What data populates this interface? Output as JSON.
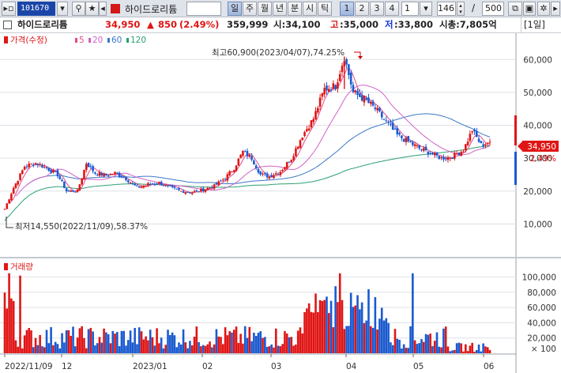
{
  "toolbar": {
    "code": "101670",
    "name": "하이드로리튬",
    "periods": [
      "일",
      "주",
      "월",
      "년",
      "분",
      "시",
      "틱"
    ],
    "active_period": "일",
    "chart_tabs": [
      "1",
      "2",
      "3",
      "4"
    ],
    "active_tab": "1",
    "interval_value": "1",
    "count_value": "146",
    "separator": "/",
    "total_value": "500"
  },
  "quote": {
    "name": "하이드로리튬",
    "price": "34,950",
    "change": "850",
    "change_pct": "(2.49%)",
    "volume": "359,999",
    "open": "시:34,100",
    "high_label": "고",
    "high": ":35,000",
    "low_label": "저",
    "low": ":33,800",
    "market_cap": "시총:7,805억",
    "period_badge": "[1일]"
  },
  "price_legend": {
    "title": "가격(수정)",
    "ma": [
      {
        "label": "5",
        "color": "#e04c8c"
      },
      {
        "label": "20",
        "color": "#d060c8"
      },
      {
        "label": "60",
        "color": "#3a78c8"
      },
      {
        "label": "120",
        "color": "#2aa070"
      }
    ]
  },
  "annotations": {
    "high": "최고60,900(2023/04/07),74.25%",
    "low": "최저14,550(2022/11/09),58.37%"
  },
  "current_price_tag": "34,950",
  "current_pct_tag": "2.49%",
  "volume_legend": "거래량",
  "volume_unit": "× 100",
  "colors": {
    "up": "#e01515",
    "down": "#1a5ad0",
    "ma5": "#e04c8c",
    "ma20": "#d060c8",
    "ma60": "#3a78c8",
    "ma120": "#2aa070"
  },
  "chart_data": [
    {
      "type": "candlestick",
      "title": "하이드로리튬 가격(수정)",
      "ylim": [
        0,
        68000
      ],
      "yticks": [
        "10,000",
        "20,000",
        "30,000",
        "40,000",
        "50,000",
        "60,000"
      ],
      "xticks": [
        "2022/11/09",
        "12",
        "2023/01",
        "02",
        "03",
        "04",
        "05",
        "06"
      ],
      "high": {
        "date": "2023/04/07",
        "value": 60900
      },
      "low": {
        "date": "2022/11/09",
        "value": 14550
      },
      "last_close": 34950,
      "close_path": [
        [
          0,
          14600
        ],
        [
          4,
          21000
        ],
        [
          9,
          27500
        ],
        [
          14,
          28500
        ],
        [
          19,
          27000
        ],
        [
          24,
          25000
        ],
        [
          28,
          20000
        ],
        [
          33,
          20000
        ],
        [
          37,
          28500
        ],
        [
          41,
          25500
        ],
        [
          46,
          24800
        ],
        [
          50,
          25500
        ],
        [
          55,
          23800
        ],
        [
          60,
          21000
        ],
        [
          65,
          22000
        ],
        [
          70,
          22500
        ],
        [
          75,
          21000
        ],
        [
          80,
          20000
        ],
        [
          85,
          19600
        ],
        [
          90,
          20400
        ],
        [
          95,
          21500
        ],
        [
          100,
          24000
        ],
        [
          104,
          27000
        ],
        [
          108,
          32000
        ],
        [
          112,
          30000
        ],
        [
          116,
          25000
        ],
        [
          120,
          24500
        ],
        [
          125,
          26000
        ],
        [
          130,
          30000
        ],
        [
          135,
          37000
        ],
        [
          140,
          42000
        ],
        [
          145,
          51000
        ],
        [
          150,
          52000
        ],
        [
          154,
          60900
        ],
        [
          158,
          50000
        ],
        [
          163,
          48000
        ],
        [
          168,
          45000
        ],
        [
          173,
          41000
        ],
        [
          178,
          37000
        ],
        [
          183,
          35000
        ],
        [
          188,
          33000
        ],
        [
          193,
          31500
        ],
        [
          198,
          30000
        ],
        [
          203,
          30500
        ],
        [
          208,
          32500
        ],
        [
          212,
          38500
        ],
        [
          216,
          34000
        ],
        [
          220,
          34950
        ]
      ]
    },
    {
      "type": "bar",
      "title": "거래량",
      "unit": "× 100",
      "ylim": [
        0,
        110000
      ],
      "yticks": [
        "20,000",
        "40,000",
        "60,000",
        "80,000",
        "100,000"
      ],
      "xticks": [
        "2022/11/09",
        "12",
        "2023/01",
        "02",
        "03",
        "04",
        "05",
        "06"
      ],
      "peak_values": [
        105000,
        102000,
        105000,
        105000,
        88000,
        84000
      ]
    }
  ]
}
